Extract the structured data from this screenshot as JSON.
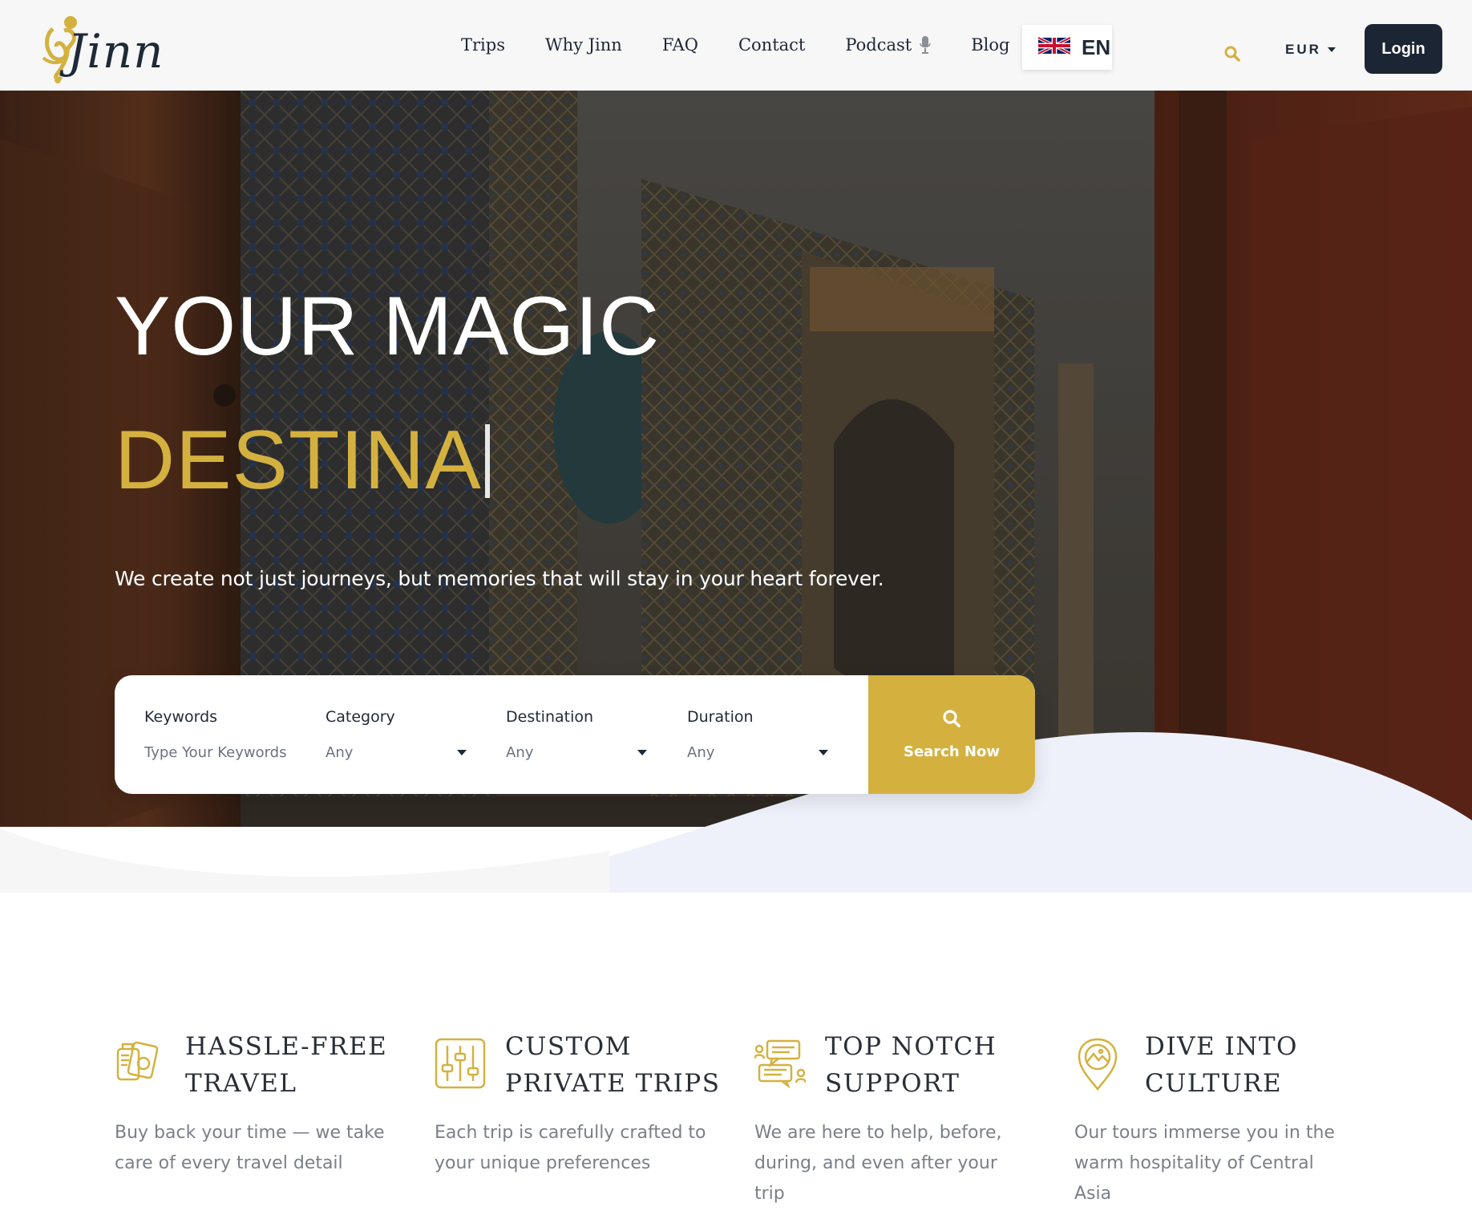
{
  "brand": {
    "name": "Jinn"
  },
  "nav": {
    "items": [
      "Trips",
      "Why Jinn",
      "FAQ",
      "Contact",
      "Podcast",
      "Blog"
    ]
  },
  "language": {
    "code": "EN",
    "flag_icon": "uk-flag-icon"
  },
  "currency": {
    "value": "EUR"
  },
  "login": {
    "label": "Login"
  },
  "hero": {
    "title_line1": "YOUR MAGIC",
    "title_line2": "DESTINA",
    "subtitle": "We create not just journeys, but memories that will stay in your heart forever."
  },
  "search": {
    "fields": [
      {
        "label": "Keywords",
        "value": "Type Your Keywords"
      },
      {
        "label": "Category",
        "value": "Any"
      },
      {
        "label": "Destination",
        "value": "Any"
      },
      {
        "label": "Duration",
        "value": "Any"
      }
    ],
    "button_label": "Search Now"
  },
  "features": [
    {
      "icon": "passport-icon",
      "title": "HASSLE-FREE TRAVEL",
      "desc": "Buy back your time — we take care of every travel detail"
    },
    {
      "icon": "sliders-icon",
      "title": "CUSTOM PRIVATE TRIPS",
      "desc": "Each trip is carefully crafted to your unique preferences"
    },
    {
      "icon": "chat-support-icon",
      "title": "TOP NOTCH SUPPORT",
      "desc": "We are here to help, before, during, and even after your trip"
    },
    {
      "icon": "map-pin-icon",
      "title": "DIVE INTO CULTURE",
      "desc": "Our tours immerse you in the warm hospitality of Central Asia"
    }
  ],
  "colors": {
    "accent": "#d4b13f",
    "dark": "#1c2533",
    "wave": "#eef1fa"
  }
}
